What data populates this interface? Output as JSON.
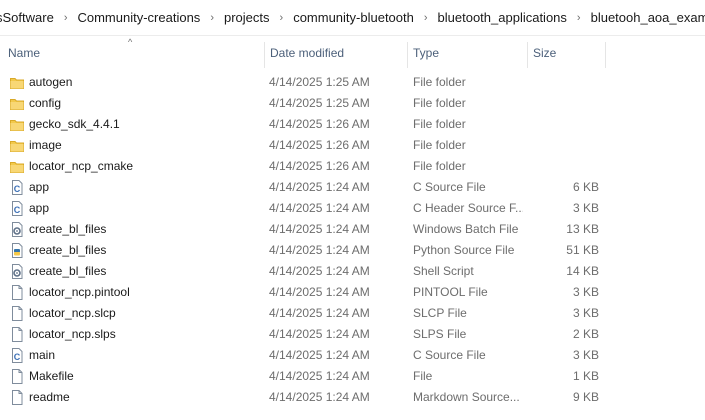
{
  "breadcrumb": [
    "sSoftware",
    "Community-creations",
    "projects",
    "community-bluetooth",
    "bluetooth_applications",
    "bluetooh_aoa_example"
  ],
  "columns": {
    "name": "Name",
    "date": "Date modified",
    "type": "Type",
    "size": "Size"
  },
  "files": [
    {
      "name": "autogen",
      "date": "4/14/2025 1:25 AM",
      "type": "File folder",
      "size": "",
      "icon": "folder"
    },
    {
      "name": "config",
      "date": "4/14/2025 1:25 AM",
      "type": "File folder",
      "size": "",
      "icon": "folder"
    },
    {
      "name": "gecko_sdk_4.4.1",
      "date": "4/14/2025 1:26 AM",
      "type": "File folder",
      "size": "",
      "icon": "folder"
    },
    {
      "name": "image",
      "date": "4/14/2025 1:26 AM",
      "type": "File folder",
      "size": "",
      "icon": "folder"
    },
    {
      "name": "locator_ncp_cmake",
      "date": "4/14/2025 1:26 AM",
      "type": "File folder",
      "size": "",
      "icon": "folder"
    },
    {
      "name": "app",
      "date": "4/14/2025 1:24 AM",
      "type": "C Source File",
      "size": "6 KB",
      "icon": "c-source"
    },
    {
      "name": "app",
      "date": "4/14/2025 1:24 AM",
      "type": "C Header Source F...",
      "size": "3 KB",
      "icon": "c-source"
    },
    {
      "name": "create_bl_files",
      "date": "4/14/2025 1:24 AM",
      "type": "Windows Batch File",
      "size": "13 KB",
      "icon": "gear-file"
    },
    {
      "name": "create_bl_files",
      "date": "4/14/2025 1:24 AM",
      "type": "Python Source File",
      "size": "51 KB",
      "icon": "python-file"
    },
    {
      "name": "create_bl_files",
      "date": "4/14/2025 1:24 AM",
      "type": "Shell Script",
      "size": "14 KB",
      "icon": "gear-file"
    },
    {
      "name": "locator_ncp.pintool",
      "date": "4/14/2025 1:24 AM",
      "type": "PINTOOL File",
      "size": "3 KB",
      "icon": "blank-file"
    },
    {
      "name": "locator_ncp.slcp",
      "date": "4/14/2025 1:24 AM",
      "type": "SLCP File",
      "size": "3 KB",
      "icon": "blank-file"
    },
    {
      "name": "locator_ncp.slps",
      "date": "4/14/2025 1:24 AM",
      "type": "SLPS File",
      "size": "2 KB",
      "icon": "blank-file"
    },
    {
      "name": "main",
      "date": "4/14/2025 1:24 AM",
      "type": "C Source File",
      "size": "3 KB",
      "icon": "c-source"
    },
    {
      "name": "Makefile",
      "date": "4/14/2025 1:24 AM",
      "type": "File",
      "size": "1 KB",
      "icon": "blank-file"
    },
    {
      "name": "readme",
      "date": "4/14/2025 1:24 AM",
      "type": "Markdown Source...",
      "size": "9 KB",
      "icon": "blank-file"
    }
  ]
}
